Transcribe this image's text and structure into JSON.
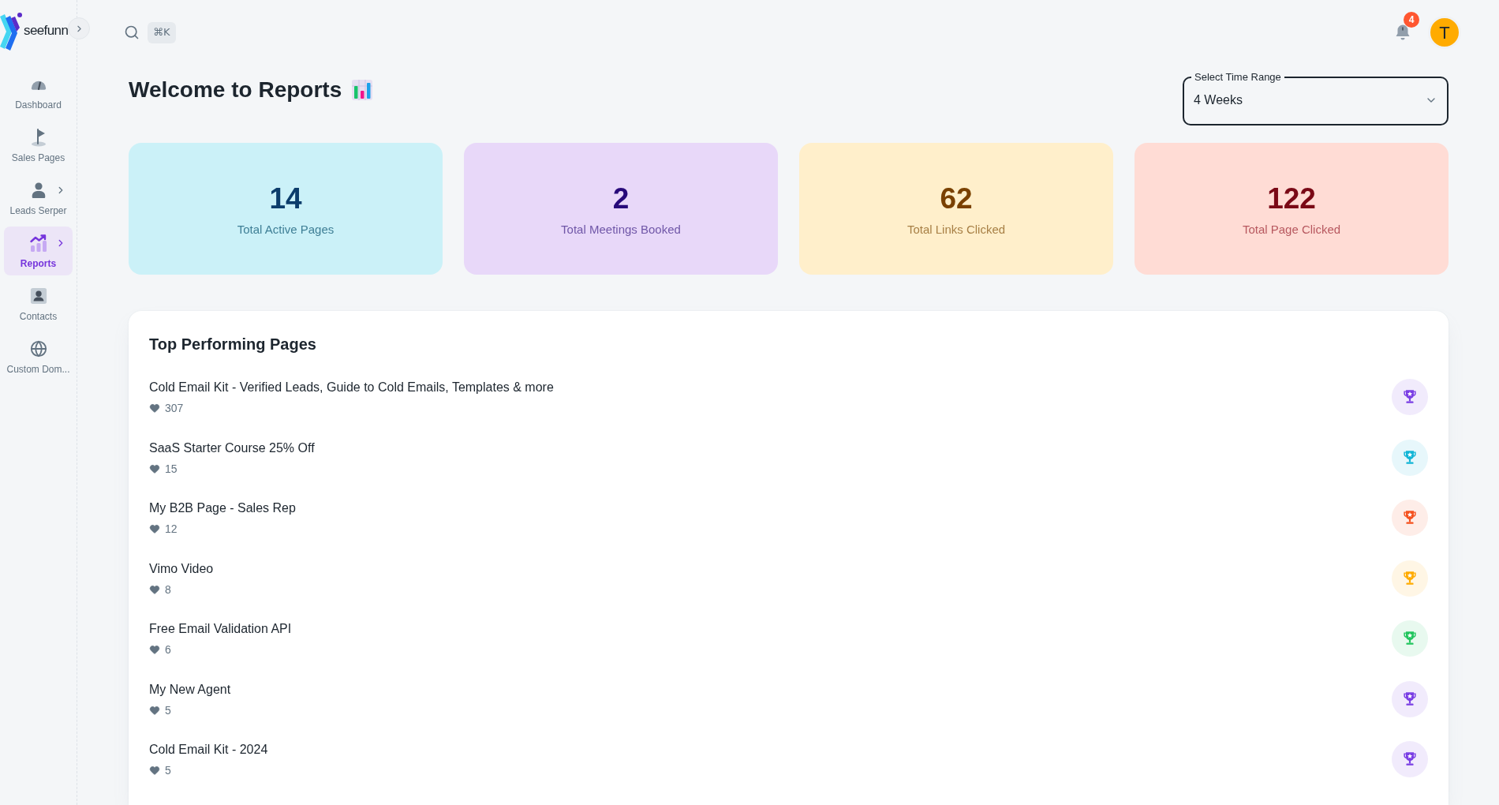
{
  "sidebar": {
    "logo_text": "seefunn",
    "items": [
      {
        "label": "Dashboard",
        "selected": false,
        "has_submenu": false
      },
      {
        "label": "Sales Pages",
        "selected": false,
        "has_submenu": false
      },
      {
        "label": "Leads Serper",
        "selected": false,
        "has_submenu": true
      },
      {
        "label": "Reports",
        "selected": true,
        "has_submenu": true
      },
      {
        "label": "Contacts",
        "selected": false,
        "has_submenu": false
      },
      {
        "label": "Custom Dom...",
        "selected": false,
        "has_submenu": false
      }
    ]
  },
  "topbar": {
    "shortcut": "⌘K",
    "notification_count": "4",
    "avatar_initial": "T"
  },
  "header": {
    "title": "Welcome to Reports",
    "time_range": {
      "label": "Select Time Range",
      "value": "4 Weeks"
    }
  },
  "stats": [
    {
      "value": "14",
      "label": "Total Active Pages",
      "color": "#cbf1f8"
    },
    {
      "value": "2",
      "label": "Total Meetings Booked",
      "color": "#e8d8f9"
    },
    {
      "value": "62",
      "label": "Total Links Clicked",
      "color": "#ffefcb"
    },
    {
      "value": "122",
      "label": "Total Page Clicked",
      "color": "#ffdcd5"
    }
  ],
  "top_pages": {
    "title": "Top Performing Pages",
    "items": [
      {
        "name": "Cold Email Kit - Verified Leads, Guide to Cold Emails, Templates & more",
        "likes": "307",
        "color": "#7a3fe4"
      },
      {
        "name": "SaaS Starter Course 25% Off",
        "likes": "15",
        "color": "#12b5d6"
      },
      {
        "name": "My B2B Page - Sales Rep",
        "likes": "12",
        "color": "#f4511e"
      },
      {
        "name": "Vimo Video",
        "likes": "8",
        "color": "#ffab00"
      },
      {
        "name": "Free Email Validation API",
        "likes": "6",
        "color": "#22c55e"
      },
      {
        "name": "My New Agent",
        "likes": "5",
        "color": "#7a3fe4"
      },
      {
        "name": "Cold Email Kit - 2024",
        "likes": "5",
        "color": "#7a3fe4"
      }
    ]
  }
}
